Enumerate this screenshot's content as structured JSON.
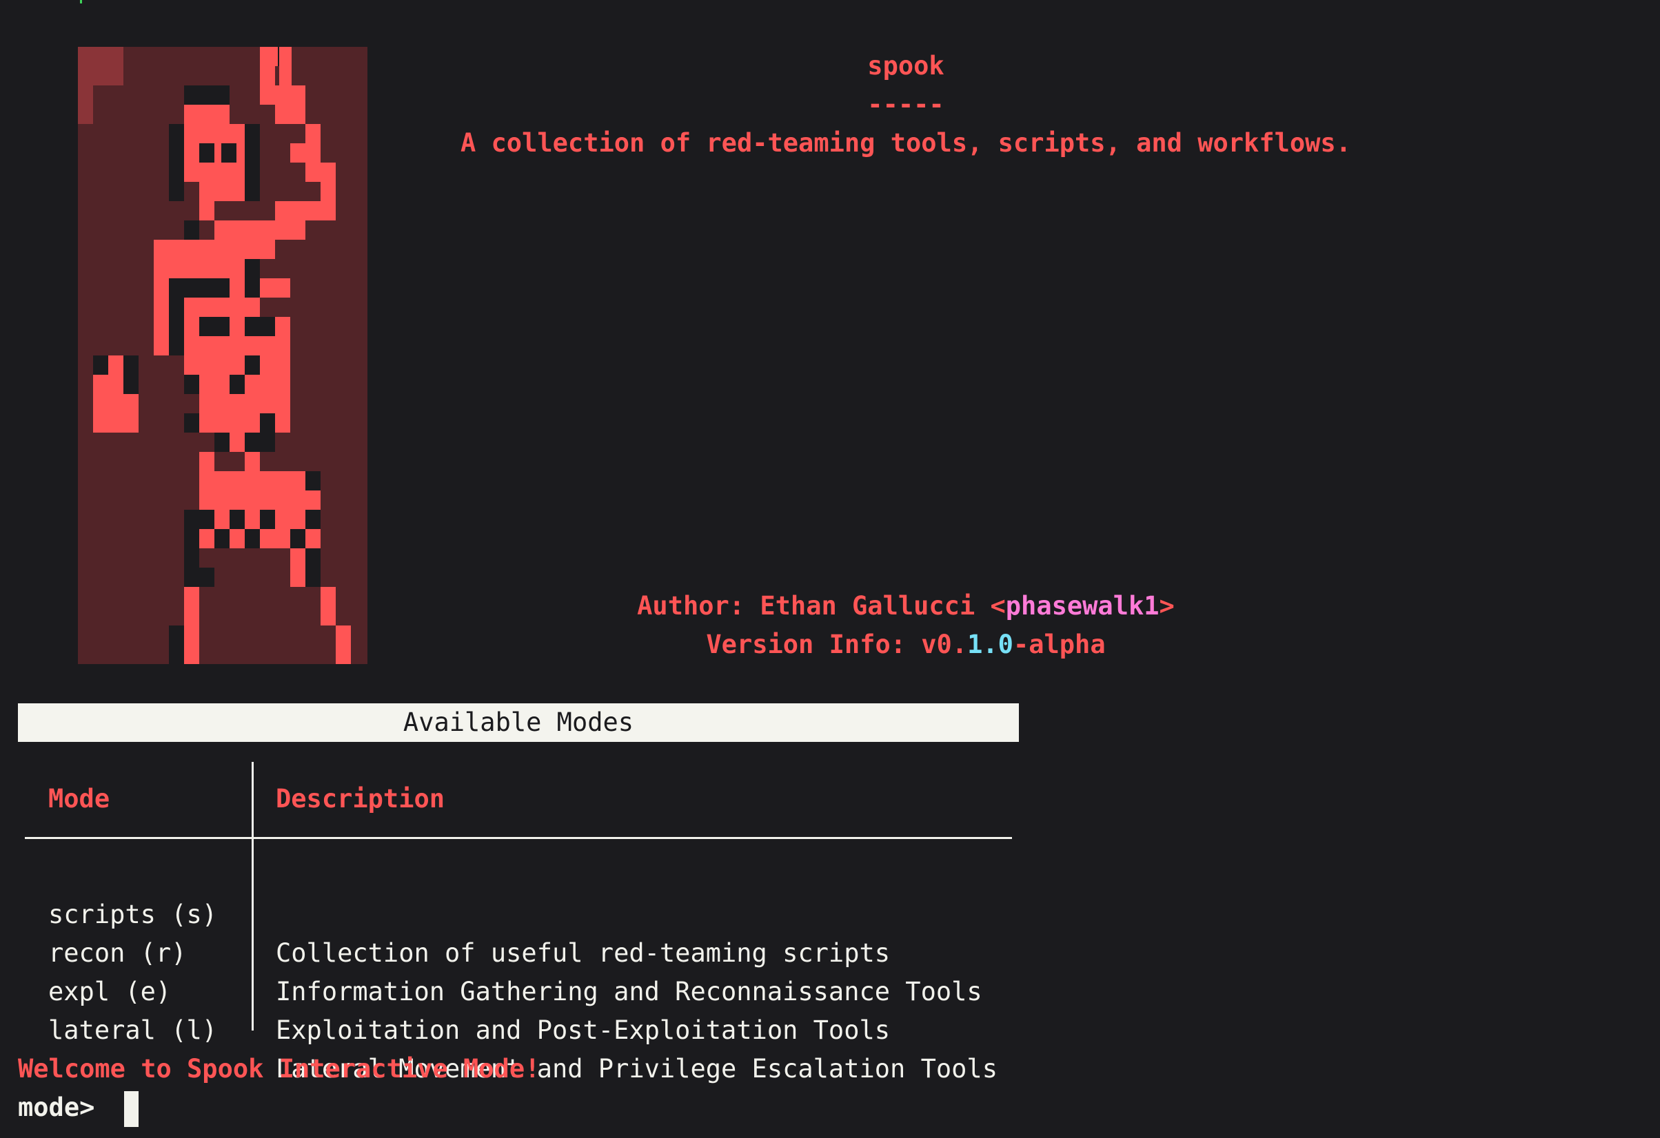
{
  "theme": {
    "background": "#1b1b1e",
    "accent_red": "#ff5555",
    "art_dark": "#522428",
    "art_corner": "#8a3438",
    "text_light": "#f2f2ec",
    "handle_magenta": "#ff7bd8",
    "version_cyan": "#77e0f6"
  },
  "banner": {
    "art_name": "ascii-skeleton-art",
    "title": "spook",
    "separator": "-----",
    "description": "A collection of red-teaming tools, scripts, and workflows.",
    "author_label": "Author: Ethan Gallucci <",
    "author_handle": "phasewalk1",
    "author_close": ">",
    "version_label": "Version Info: v0.",
    "version_minor": "1.0",
    "version_suffix": "-alpha"
  },
  "modes_table": {
    "title": "Available Modes",
    "headers": {
      "mode": "Mode",
      "description": "Description"
    },
    "rows": [
      {
        "mode": "scripts (s)",
        "description": "Collection of useful red-teaming scripts"
      },
      {
        "mode": "recon (r)",
        "description": "Information Gathering and Reconnaissance Tools"
      },
      {
        "mode": "expl (e)",
        "description": "Exploitation and Post-Exploitation Tools"
      },
      {
        "mode": "lateral (l)",
        "description": "Lateral Movement and Privilege Escalation Tools"
      }
    ]
  },
  "console": {
    "welcome": "Welcome to Spook Interactive Mode!",
    "prompt": "mode> "
  }
}
